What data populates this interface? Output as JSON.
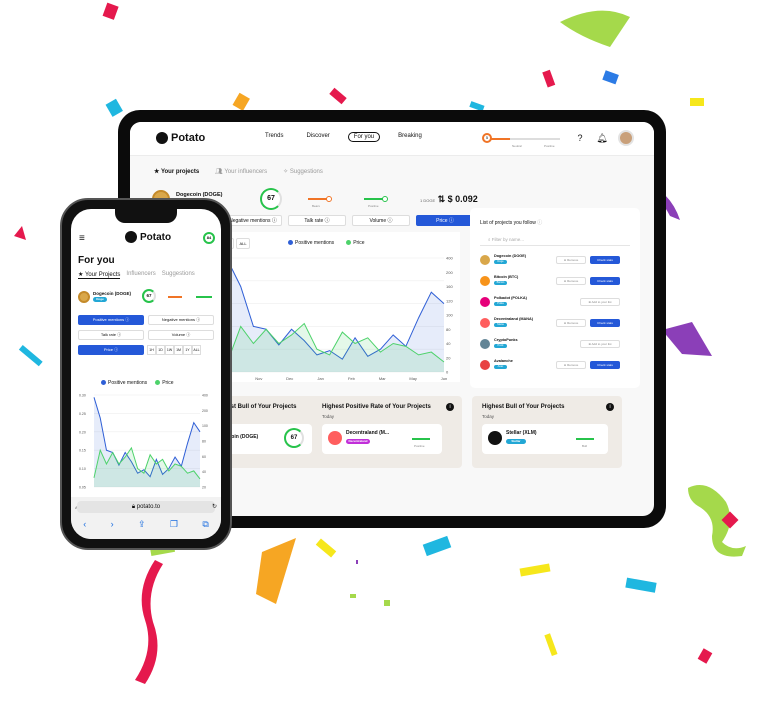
{
  "tablet": {
    "brand": "Potato",
    "nav": [
      "Trends",
      "Discover",
      "For you",
      "Breaking"
    ],
    "slider_labels": [
      "Neutral",
      "Positive"
    ],
    "slider_value": "5",
    "tabs": [
      "Your projects",
      "Your influencers",
      "Suggestions"
    ],
    "project": {
      "name": "Dogecoin (DOGE)",
      "badge": "Doge",
      "score": "67",
      "score_label": "Bull Score",
      "bear_label": "Bears",
      "sentiment_label": "Positive"
    },
    "price": {
      "label": "1 DOGE",
      "value": "$ 0.092"
    },
    "metric_buttons": [
      "Negative mentions ⓘ",
      "Talk rate ⓘ",
      "Volume ⓘ",
      "Price ⓘ"
    ],
    "range_buttons": [
      "Y",
      "ALL"
    ],
    "legend": [
      "Positive mentions",
      "Price"
    ],
    "x_labels": [
      "Oct",
      "Nov",
      "Dec",
      "Jan",
      "Feb",
      "Mar",
      "May",
      "Jun"
    ],
    "y_labels": [
      "400",
      "200",
      "160",
      "120",
      "100",
      "80",
      "40",
      "20",
      "0"
    ],
    "follow": {
      "title": "List of projects you follow",
      "search_placeholder": "Filter by name...",
      "items": [
        {
          "name": "Dogecoin (DOGE)",
          "badge": "Doge",
          "action": "Check stats",
          "remove": "⊖ Remove",
          "color": "#d9a74a"
        },
        {
          "name": "Bitcoin (BTC)",
          "badge": "Bitcoin",
          "action": "Check stats",
          "remove": "⊖ Remove",
          "color": "#f7931a"
        },
        {
          "name": "Polkadot (POLKA)",
          "badge": "Polka",
          "action": "⊕ Add to your list",
          "remove": "",
          "color": "#e6007a"
        },
        {
          "name": "Decentraland (MANA)",
          "badge": "Mana",
          "action": "Check stats",
          "remove": "⊖ Remove",
          "color": "#ff5e5e"
        },
        {
          "name": "CryptoPunks",
          "badge": "Punk",
          "action": "⊕ Add to your list",
          "remove": "",
          "color": "#638596"
        },
        {
          "name": "Avalanche",
          "badge": "Avax",
          "action": "Check stats",
          "remove": "⊖ Remove",
          "color": "#e84142"
        }
      ]
    },
    "cards": [
      {
        "title": "Highest Bull of Your Projects",
        "subtitle": "",
        "project": "Dogecoin (DOGE)",
        "score": "67"
      },
      {
        "title": "Highest Positive Rate of Your Projects",
        "subtitle": "Today",
        "project": "Decentraland (M...",
        "badge": "Decentraland",
        "meter": "Positive"
      },
      {
        "title": "Highest Bull of Your Projects",
        "subtitle": "Today",
        "project": "Stellar (XLM)",
        "badge": "Stellar",
        "meter": "Bull"
      }
    ]
  },
  "phone": {
    "brand": "Potato",
    "score": "84",
    "title": "For you",
    "tabs": [
      "★ Your Projects",
      "Influencers",
      "Suggestions"
    ],
    "project": {
      "name": "Dogecoin (DOGE)",
      "badge": "Doge",
      "score": "67"
    },
    "metric_buttons": [
      "Positive mentions ⓘ",
      "Negative mentions ⓘ",
      "Talk rate ⓘ",
      "Volume ⓘ",
      "Price ⓘ"
    ],
    "ranges": [
      "1H",
      "1D",
      "1W",
      "1M",
      "1Y",
      "ALL"
    ],
    "legend": [
      "Positive mentions",
      "Price"
    ],
    "y_left": [
      "0.30",
      "0.25",
      "0.20",
      "0.15",
      "0.10",
      "0.05"
    ],
    "y_right": [
      "400",
      "200",
      "100",
      "80",
      "60",
      "40",
      "20"
    ],
    "url": "potato.to",
    "url_prefix": "AA"
  },
  "chart_data": {
    "type": "line",
    "series": [
      {
        "name": "Positive mentions",
        "values": [
          390,
          300,
          160,
          150,
          95,
          150,
          110,
          60,
          75,
          45,
          120,
          55,
          80,
          130,
          90,
          190,
          280,
          240
        ]
      },
      {
        "name": "Price",
        "values": [
          40,
          160,
          100,
          150,
          100,
          130,
          170,
          80,
          60,
          140,
          100,
          120,
          70,
          100,
          90,
          60,
          70,
          35
        ]
      }
    ],
    "x": [
      "Oct",
      "Nov",
      "Dec",
      "Jan",
      "Feb",
      "Mar",
      "May",
      "Jun"
    ],
    "ylim": [
      0,
      400
    ]
  },
  "colors": {
    "accent": "#2458d8",
    "positive": "#27c34b",
    "blue_line": "#2f5fd6",
    "green_line": "#4dd26a"
  }
}
